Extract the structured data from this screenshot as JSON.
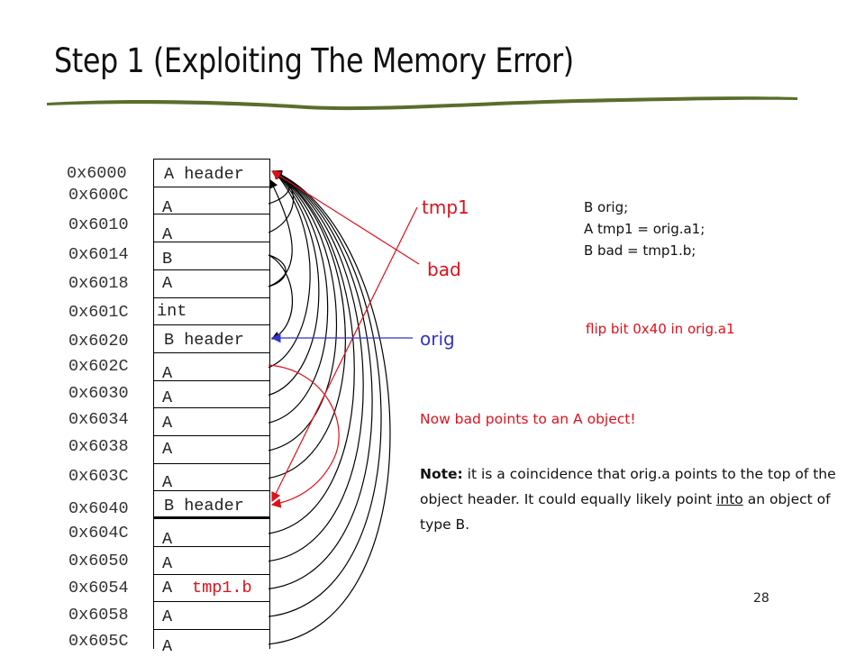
{
  "slide": {
    "title": "Step 1 (Exploiting The Memory Error)",
    "page_number": "28"
  },
  "memory": {
    "rows": [
      {
        "address": "0x6000",
        "content": "A header",
        "extra": ""
      },
      {
        "address": "0x600C",
        "content": "A",
        "extra": ""
      },
      {
        "address": "0x6010",
        "content": "A",
        "extra": ""
      },
      {
        "address": "0x6014",
        "content": "B",
        "extra": ""
      },
      {
        "address": "0x6018",
        "content": "A",
        "extra": ""
      },
      {
        "address": "0x601C",
        "content": "int",
        "extra": ""
      },
      {
        "address": "0x6020",
        "content": "B header",
        "extra": ""
      },
      {
        "address": "0x602C",
        "content": "A",
        "extra": ""
      },
      {
        "address": "0x6030",
        "content": "A",
        "extra": ""
      },
      {
        "address": "0x6034",
        "content": "A",
        "extra": ""
      },
      {
        "address": "0x6038",
        "content": "A",
        "extra": ""
      },
      {
        "address": "0x603C",
        "content": "A",
        "extra": ""
      },
      {
        "address": "0x6040",
        "content": "B header",
        "extra": ""
      },
      {
        "address": "0x604C",
        "content": "A",
        "extra": ""
      },
      {
        "address": "0x6050",
        "content": "A",
        "extra": ""
      },
      {
        "address": "0x6054",
        "content": "A",
        "extra": "tmp1.b"
      },
      {
        "address": "0x6058",
        "content": "A",
        "extra": ""
      },
      {
        "address": "0x605C",
        "content": "A",
        "extra": ""
      }
    ]
  },
  "pointers": {
    "tmp1": "tmp1",
    "bad": "bad",
    "orig": "orig"
  },
  "code": {
    "lines": [
      "B orig;",
      "A tmp1 = orig.a1;",
      "B bad = tmp1.b;"
    ]
  },
  "annotations": {
    "flip": "flip bit 0x40 in orig.a1",
    "now_bad": "Now bad points to an A object!",
    "note_label": "Note:",
    "note_part1": " it is a coincidence that orig.a points to the top of the object header.  It could equally likely point ",
    "note_underlined": "into",
    "note_part2": " an object of type B."
  },
  "colors": {
    "red": "#e0101a",
    "blue": "#3333cc",
    "green_rule": "#5a6e2c",
    "text": "#111111"
  }
}
